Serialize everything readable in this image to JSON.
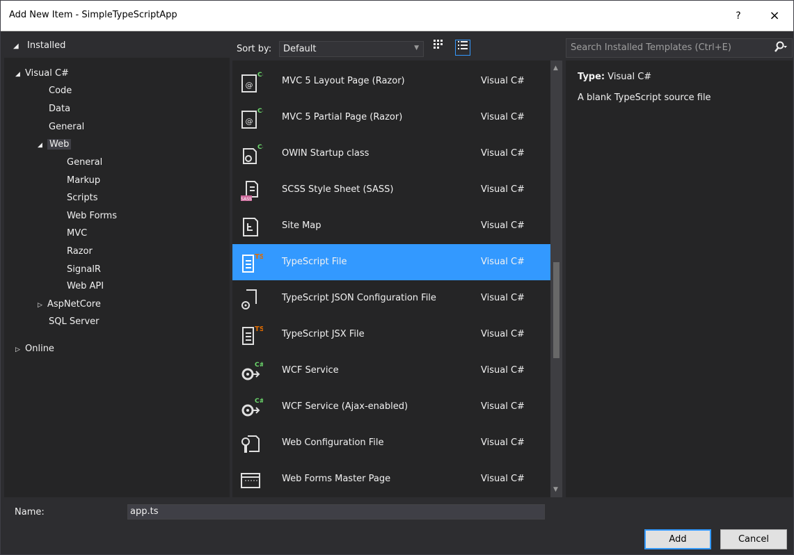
{
  "window": {
    "title": "Add New Item - SimpleTypeScriptApp",
    "help_glyph": "?",
    "close_glyph": "×"
  },
  "left": {
    "installed_label": "Installed",
    "tree": [
      {
        "label": "Visual C#",
        "expanded": true
      },
      {
        "label": "Code"
      },
      {
        "label": "Data"
      },
      {
        "label": "General"
      },
      {
        "label": "Web",
        "expanded": true,
        "selected": true
      },
      {
        "label": "General"
      },
      {
        "label": "Markup"
      },
      {
        "label": "Scripts"
      },
      {
        "label": "Web Forms"
      },
      {
        "label": "MVC"
      },
      {
        "label": "Razor"
      },
      {
        "label": "SignalR"
      },
      {
        "label": "Web API"
      },
      {
        "label": "AspNetCore",
        "expanded": false
      },
      {
        "label": "SQL Server"
      },
      {
        "label": "Online",
        "expanded": false
      }
    ]
  },
  "sort": {
    "label": "Sort by:",
    "value": "Default"
  },
  "search": {
    "placeholder": "Search Installed Templates (Ctrl+E)"
  },
  "items": [
    {
      "name": "MVC 5 Layout Page (Razor)",
      "lang": "Visual C#",
      "icon": "razor-page-icon"
    },
    {
      "name": "MVC 5 Partial Page (Razor)",
      "lang": "Visual C#",
      "icon": "razor-page-icon"
    },
    {
      "name": "OWIN Startup class",
      "lang": "Visual C#",
      "icon": "owin-icon"
    },
    {
      "name": "SCSS Style Sheet (SASS)",
      "lang": "Visual C#",
      "icon": "sass-icon"
    },
    {
      "name": "Site Map",
      "lang": "Visual C#",
      "icon": "sitemap-icon"
    },
    {
      "name": "TypeScript File",
      "lang": "Visual C#",
      "icon": "typescript-file-icon",
      "selected": true
    },
    {
      "name": "TypeScript JSON Configuration File",
      "lang": "Visual C#",
      "icon": "json-config-icon"
    },
    {
      "name": "TypeScript JSX File",
      "lang": "Visual C#",
      "icon": "typescript-file-icon"
    },
    {
      "name": "WCF Service",
      "lang": "Visual C#",
      "icon": "wcf-service-icon"
    },
    {
      "name": "WCF Service (Ajax-enabled)",
      "lang": "Visual C#",
      "icon": "wcf-service-icon"
    },
    {
      "name": "Web Configuration File",
      "lang": "Visual C#",
      "icon": "web-config-icon"
    },
    {
      "name": "Web Forms Master Page",
      "lang": "Visual C#",
      "icon": "master-page-icon"
    }
  ],
  "details": {
    "type_label": "Type:",
    "type_value": "Visual C#",
    "description": "A blank TypeScript source file"
  },
  "footer": {
    "name_label": "Name:",
    "name_value": "app.ts",
    "add_label": "Add",
    "cancel_label": "Cancel"
  },
  "colors": {
    "selection": "#3399ff",
    "background": "#2d2d30",
    "panel": "#252526",
    "ts_accent": "#e06c00",
    "sass_accent": "#cc6699"
  }
}
